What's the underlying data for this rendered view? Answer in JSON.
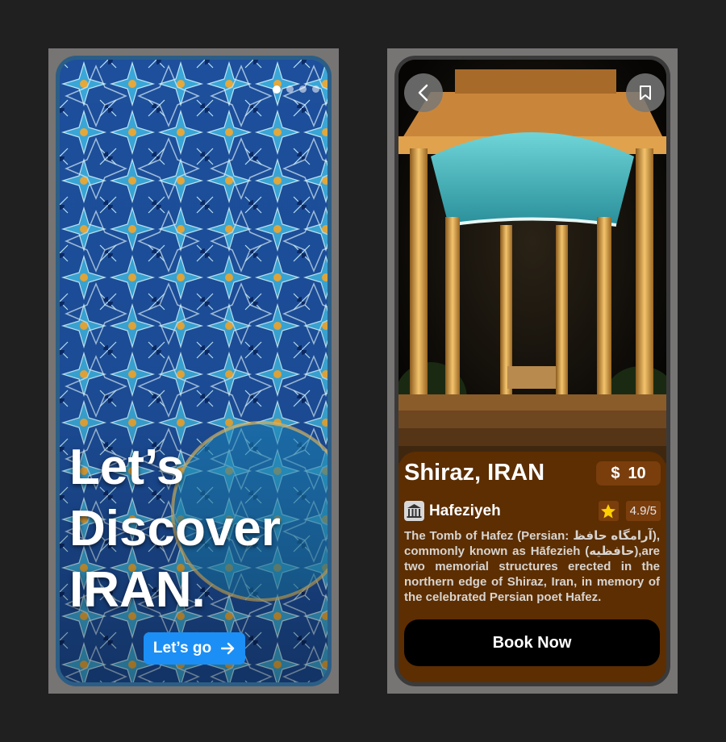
{
  "screen1": {
    "title_lines": [
      "Let’s",
      "Discover",
      "IRAN."
    ],
    "cta_label": "Let’s go",
    "cta_icon": "arrow-right-icon",
    "pager_count": 4,
    "pager_active": 0
  },
  "screen2": {
    "back_icon": "chevron-left-icon",
    "bookmark_icon": "bookmark-icon",
    "title": "Shiraz, IRAN",
    "price_symbol": "$",
    "price_value": "10",
    "place_icon": "monument-icon",
    "place_name": "Hafeziyeh",
    "rating_icon": "star-icon",
    "rating": "4.9/5",
    "description": "The Tomb of Hafez (Persian: آرامگاه حافظ), commonly known as Hāfezieh (حافظیه),are two memorial structures erected in the northern edge of Shiraz, Iran, in memory of the celebrated Persian poet Hafez.",
    "book_label": "Book Now"
  },
  "colors": {
    "background": "#202020",
    "frame": "#777474",
    "cta_blue": "#1b8ff5",
    "sheet_brown": "#5c2e02",
    "badge_brown": "#7a3d0c",
    "star_yellow": "#ffd000"
  }
}
